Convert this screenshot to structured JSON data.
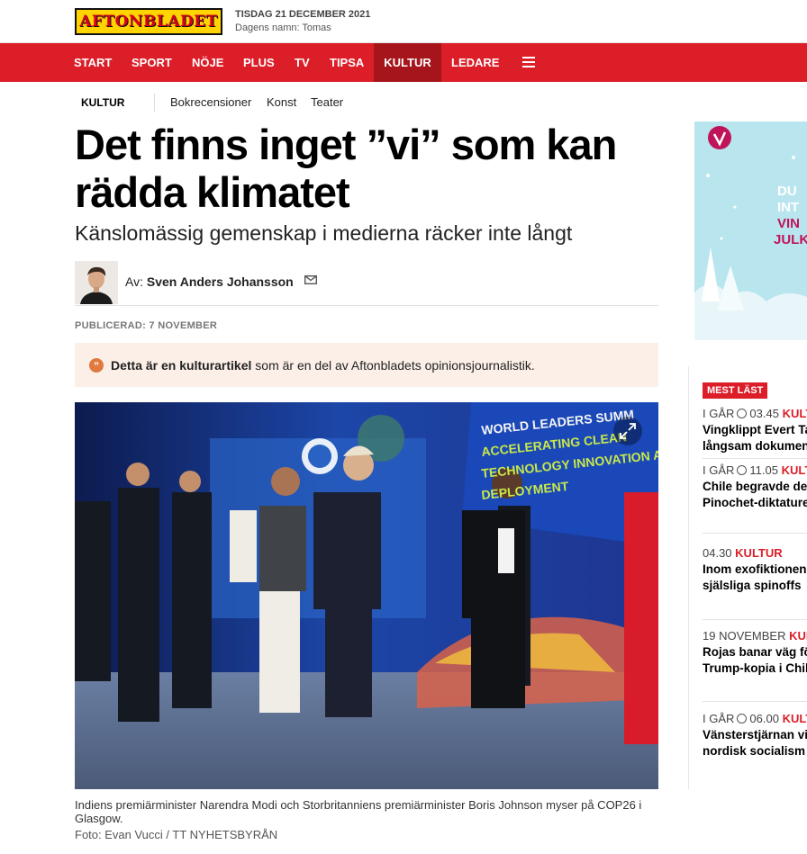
{
  "header": {
    "logo": "AFTONBLADET",
    "date": "TISDAG 21 DECEMBER 2021",
    "name_day": "Dagens namn: Tomas"
  },
  "nav": {
    "items": [
      "START",
      "SPORT",
      "NÖJE",
      "PLUS",
      "TV",
      "TIPSA",
      "KULTUR",
      "LEDARE"
    ],
    "active": "KULTUR",
    "menu_icon": "hamburger-icon"
  },
  "subnav": {
    "section": "KULTUR",
    "links": [
      "Bokrecensioner",
      "Konst",
      "Teater"
    ]
  },
  "article": {
    "title": "Det finns inget ”vi” som kan rädda klimatet",
    "subtitle": "Känslomässig gemenskap i medierna räcker inte långt",
    "author_prefix": "Av:",
    "author": "Sven Anders Johansson",
    "published": "PUBLICERAD: 7 NOVEMBER",
    "notice_bold": "Detta är en kulturartikel",
    "notice_rest": " som är en del av Aftonbladets opinionsjournalistik.",
    "photo_text_1": "WORLD LEADERS SUMM",
    "photo_text_2": "ACCELERATING CLEAN",
    "photo_text_3": "TECHNOLOGY INNOVATION A",
    "photo_text_4": "DEPLOYMENT",
    "caption": "Indiens premiärminister Narendra Modi och Storbritanniens premiärminister Boris Johnson myser på COP26 i Glasgow.",
    "credit": "Foto: Evan Vucci / TT NYHETSBYRÅN"
  },
  "ad": {
    "line1": "DU",
    "line2": "INT",
    "line3": "VIN",
    "line4": "JULK"
  },
  "most_read": {
    "badge": "MEST LÄST",
    "items": [
      {
        "time": "I GÅR",
        "clock": "03.45",
        "section": "KULTUR",
        "title1": "Vingklippt Evert Taube",
        "title2": "långsam dokumentär"
      },
      {
        "time": "I GÅR",
        "clock": "11.05",
        "section": "KULTUR",
        "title1": "Chile begravde demokratin",
        "title2": "Pinochet-diktaturen"
      },
      {
        "time": "04.30",
        "clock": "",
        "section": "KULTUR",
        "title1": "Inom exofiktionen",
        "title2": "själsliga spinoffs"
      },
      {
        "time": "19 NOVEMBER",
        "clock": "",
        "section": "KULTUR",
        "title1": "Rojas banar väg för",
        "title2": "Trump-kopia i Chile"
      },
      {
        "time": "I GÅR",
        "clock": "06.00",
        "section": "KULTUR",
        "title1": "Vänsterstjärnan vill",
        "title2": "nordisk socialism"
      }
    ]
  },
  "colors": {
    "brand_red": "#dc1e28",
    "nav_active": "#a5151b",
    "logo_yellow": "#ffd400"
  }
}
